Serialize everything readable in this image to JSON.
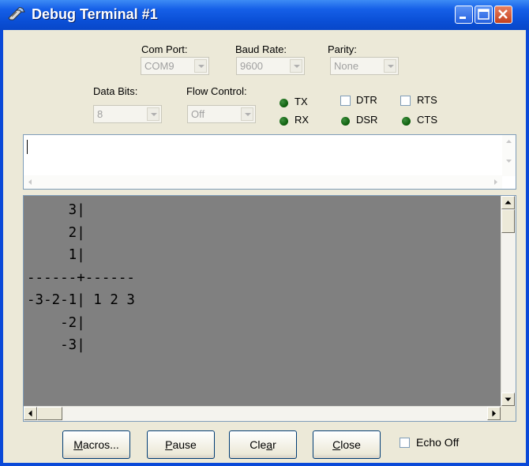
{
  "window": {
    "title": "Debug Terminal #1",
    "titlebar_color": "#0a49d8",
    "buttons": [
      "minimize-icon",
      "maximize-icon",
      "close-icon"
    ]
  },
  "settings": {
    "com_port": {
      "label": "Com Port:",
      "value": "COM9"
    },
    "baud_rate": {
      "label": "Baud Rate:",
      "value": "9600"
    },
    "parity": {
      "label": "Parity:",
      "value": "None"
    },
    "data_bits": {
      "label": "Data Bits:",
      "value": "8"
    },
    "flow_control": {
      "label": "Flow Control:",
      "value": "Off"
    }
  },
  "indicators": {
    "tx": "TX",
    "rx": "RX",
    "dsr": "DSR",
    "cts": "CTS",
    "led_color": "#0a5c0a"
  },
  "checkboxes": {
    "dtr": {
      "label": "DTR",
      "checked": false
    },
    "rts": {
      "label": "RTS",
      "checked": false
    },
    "echo_off": {
      "label": "Echo Off",
      "checked": false
    }
  },
  "input": {
    "value": ""
  },
  "output": {
    "lines": [
      "     3|",
      "     2|",
      "     1|",
      "------+------",
      "-3-2-1| 1 2 3",
      "    -2|",
      "    -3|"
    ],
    "background": "#808080"
  },
  "buttons": {
    "macros_prefix": "",
    "macros_mnemonic": "M",
    "macros_rest": "acros...",
    "pause_prefix": "",
    "pause_mnemonic": "P",
    "pause_rest": "ause",
    "clear_prefix": "Cle",
    "clear_mnemonic": "a",
    "clear_rest": "r",
    "close_prefix": "",
    "close_mnemonic": "C",
    "close_rest": "lose"
  }
}
